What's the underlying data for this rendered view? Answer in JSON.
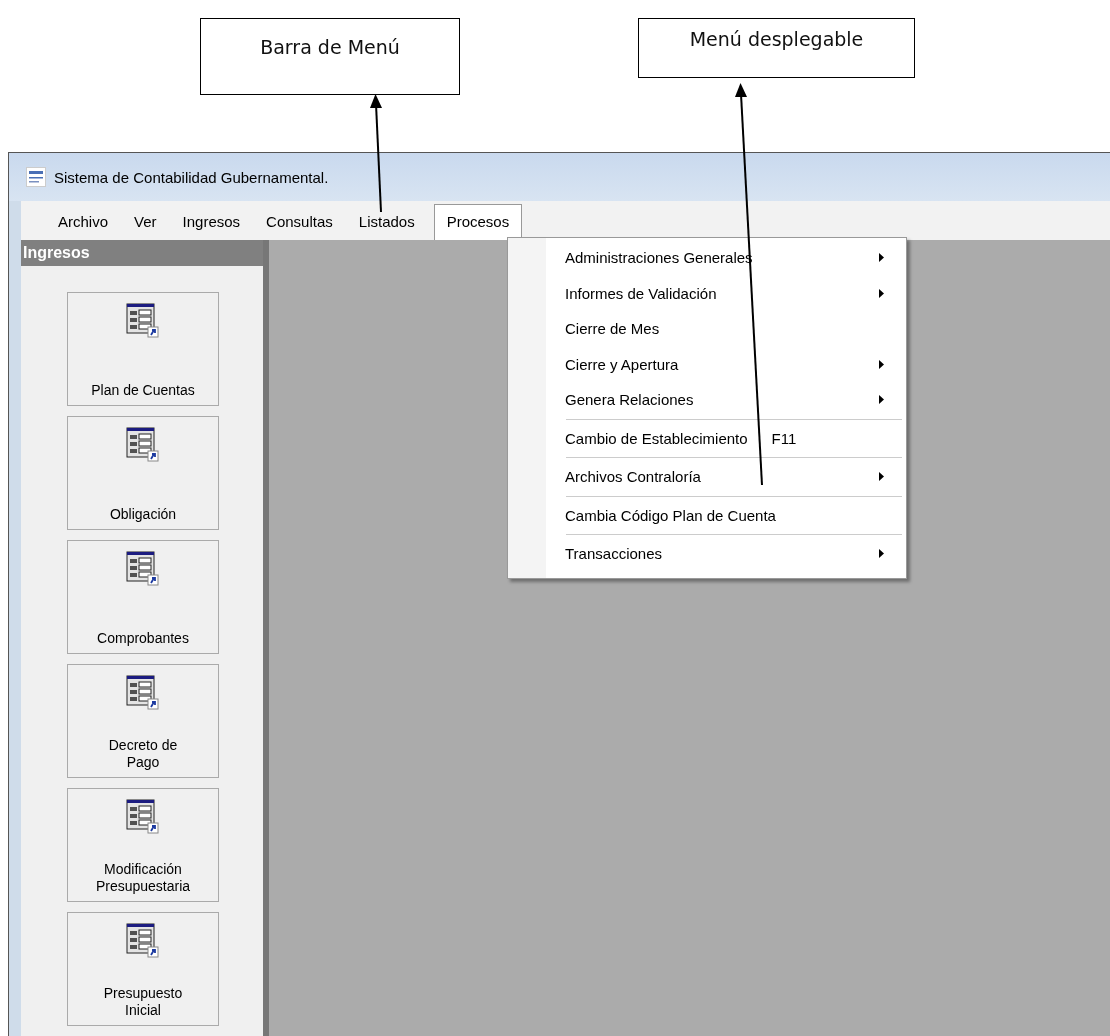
{
  "callouts": [
    {
      "text": "Barra de Menú"
    },
    {
      "text": "Menú desplegable"
    }
  ],
  "window": {
    "title": "Sistema de Contabilidad Gubernamental."
  },
  "menu_bar": [
    {
      "label": "Archivo",
      "selected": false
    },
    {
      "label": "Ver",
      "selected": false
    },
    {
      "label": "Ingresos",
      "selected": false
    },
    {
      "label": "Consultas",
      "selected": false
    },
    {
      "label": "Listados",
      "selected": false
    },
    {
      "label": "Procesos",
      "selected": true
    }
  ],
  "sidebar": {
    "title": "Ingresos",
    "buttons": [
      {
        "label": "Plan de Cuentas"
      },
      {
        "label": "Obligación"
      },
      {
        "label": "Comprobantes"
      },
      {
        "label": "Decreto de\nPago"
      },
      {
        "label": "Modificación\nPresupuestaria"
      },
      {
        "label": "Presupuesto\nInicial"
      }
    ]
  },
  "dropdown": {
    "groups": [
      [
        {
          "label": "Administraciones Generales",
          "submenu": true
        },
        {
          "label": "Informes de Validación",
          "submenu": true
        },
        {
          "label": "Cierre de Mes",
          "submenu": false
        },
        {
          "label": "Cierre y Apertura",
          "submenu": true
        },
        {
          "label": "Genera Relaciones",
          "submenu": true
        }
      ],
      [
        {
          "label": "Cambio de Establecimiento",
          "shortcut": "F11",
          "submenu": false
        }
      ],
      [
        {
          "label": "Archivos Contraloría",
          "submenu": true
        }
      ],
      [
        {
          "label": "Cambia Código Plan de Cuenta",
          "submenu": false
        }
      ],
      [
        {
          "label": "Transacciones",
          "submenu": true
        }
      ]
    ]
  }
}
